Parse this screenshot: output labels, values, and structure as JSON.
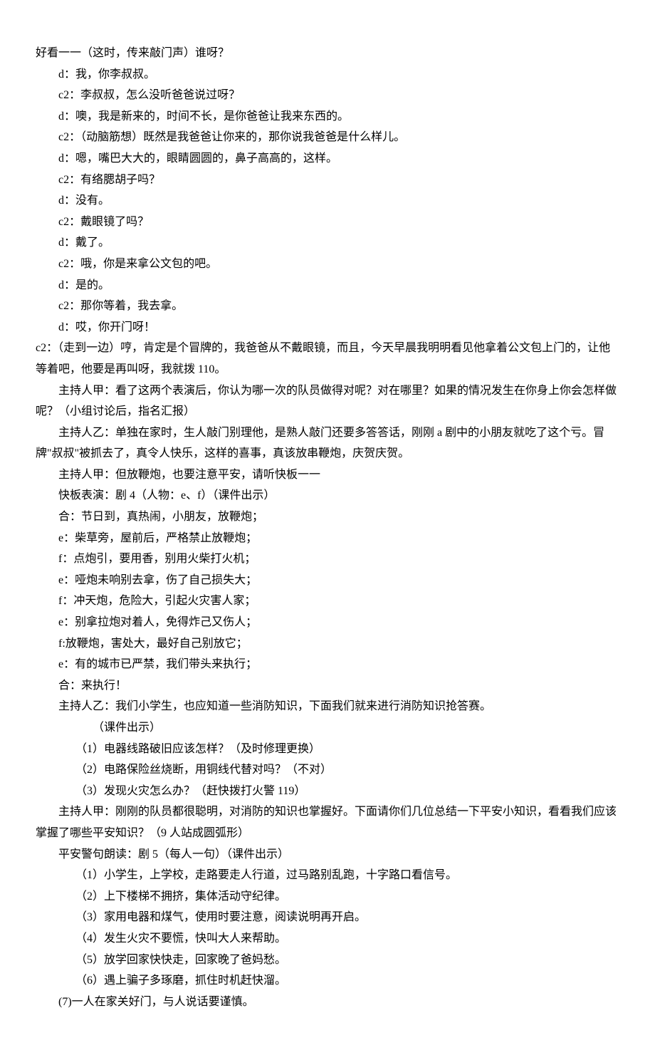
{
  "lines": [
    {
      "cls": "i0",
      "text": "好看一一（这时，传来敲门声）谁呀？"
    },
    {
      "cls": "i1",
      "text": "d：我，你李叔叔。"
    },
    {
      "cls": "i1",
      "text": "c2：李叔叔，怎么没听爸爸说过呀？"
    },
    {
      "cls": "i1",
      "text": "d：噢，我是新来的，时间不长，是你爸爸让我来东西的。"
    },
    {
      "cls": "i1",
      "text": "c2：（动脑筋想）既然是我爸爸让你来的，那你说我爸爸是什么样儿。"
    },
    {
      "cls": "i1",
      "text": "d：嗯，嘴巴大大的，眼睛圆圆的，鼻子高高的，这样。"
    },
    {
      "cls": "i1",
      "text": "c2：有络腮胡子吗？"
    },
    {
      "cls": "i1",
      "text": "d：没有。"
    },
    {
      "cls": "i1",
      "text": "c2：戴眼镜了吗？"
    },
    {
      "cls": "i1",
      "text": "d：戴了。"
    },
    {
      "cls": "i1",
      "text": "c2：哦，你是来拿公文包的吧。"
    },
    {
      "cls": "i1",
      "text": "d：是的。"
    },
    {
      "cls": "i1",
      "text": "c2：那你等着，我去拿。"
    },
    {
      "cls": "i1",
      "text": "d：哎，你开门呀！"
    },
    {
      "cls": "i0",
      "text": "c2：（走到一边）哼，肯定是个冒牌的，我爸爸从不戴眼镜，而且，今天早晨我明明看见他拿着公文包上门的，让他等着吧，他要是再叫呀，我就拨 110。"
    },
    {
      "cls": "i1",
      "text": "主持人甲：看了这两个表演后，你认为哪一次的队员做得对呢？对在哪里？如果的情况发生在你身上你会怎样做呢？（小组讨论后，指名汇报）"
    },
    {
      "cls": "i1",
      "text": "主持人乙：单独在家时，生人敲门别理他，是熟人敲门还要多答答话，刚刚 a 剧中的小朋友就吃了这个亏。冒牌\"叔叔\"被抓去了，真令人快乐，这样的喜事，真该放串鞭炮，庆贺庆贺。"
    },
    {
      "cls": "i1",
      "text": "主持人甲：但放鞭炮，也要注意平安，请听快板一一"
    },
    {
      "cls": "i1",
      "text": "快板表演：剧 4（人物：e、f）（课件出示）"
    },
    {
      "cls": "i1",
      "text": "合：节日到，真热闹，小朋友，放鞭炮；"
    },
    {
      "cls": "i1",
      "text": "e：柴草旁，屋前后，严格禁止放鞭炮；"
    },
    {
      "cls": "i1",
      "text": "f：点炮引，要用香，别用火柴打火机；"
    },
    {
      "cls": "i1",
      "text": "e：哑炮未响别去拿，伤了自己损失大；"
    },
    {
      "cls": "i1",
      "text": "f：冲天炮，危险大，引起火灾害人家；"
    },
    {
      "cls": "i1",
      "text": "e：别拿拉炮对着人，免得炸己又伤人；"
    },
    {
      "cls": "i1",
      "text": "f:放鞭炮，害处大，最好自己别放它；"
    },
    {
      "cls": "i1",
      "text": "e：有的城市已严禁，我们带头来执行；"
    },
    {
      "cls": "i1",
      "text": "合：来执行！"
    },
    {
      "cls": "i1",
      "text": "主持人乙：我们小学生，也应知道一些消防知识，下面我们就来进行消防知识抢答赛。"
    },
    {
      "cls": "i3",
      "text": "（课件出示）"
    },
    {
      "cls": "i2",
      "text": "（1）电器线路破旧应该怎样？（及时修理更换）"
    },
    {
      "cls": "i2",
      "text": "（2）电路保险丝烧断，用铜线代替对吗？（不对）"
    },
    {
      "cls": "i2",
      "text": "（3）发现火灾怎么办？（赶快拨打火警 119）"
    },
    {
      "cls": "i1",
      "text": "主持人甲：刚刚的队员都很聪明，对消防的知识也掌握好。下面请你们几位总结一下平安小知识，看看我们应该掌握了哪些平安知识？（9 人站成圆弧形）"
    },
    {
      "cls": "i1",
      "text": "平安警句朗读：剧 5（每人一句）（课件出示）"
    },
    {
      "cls": "i2",
      "text": "（1）小学生，上学校，走路要走人行道，过马路别乱跑，十字路口看信号。"
    },
    {
      "cls": "i2",
      "text": "（2）上下楼梯不拥挤，集体活动守纪律。"
    },
    {
      "cls": "i2",
      "text": "（3）家用电器和煤气，使用时要注意，阅读说明再开启。"
    },
    {
      "cls": "i2",
      "text": "（4）发生火灾不要慌，快叫大人来帮助。"
    },
    {
      "cls": "i2",
      "text": "（5）放学回家快快走，回家晚了爸妈愁。"
    },
    {
      "cls": "i2",
      "text": "（6）遇上骗子多琢磨，抓住时机赶快溜。"
    },
    {
      "cls": "i1",
      "text": "(7)一人在家关好门，与人说话要谨慎。"
    }
  ]
}
